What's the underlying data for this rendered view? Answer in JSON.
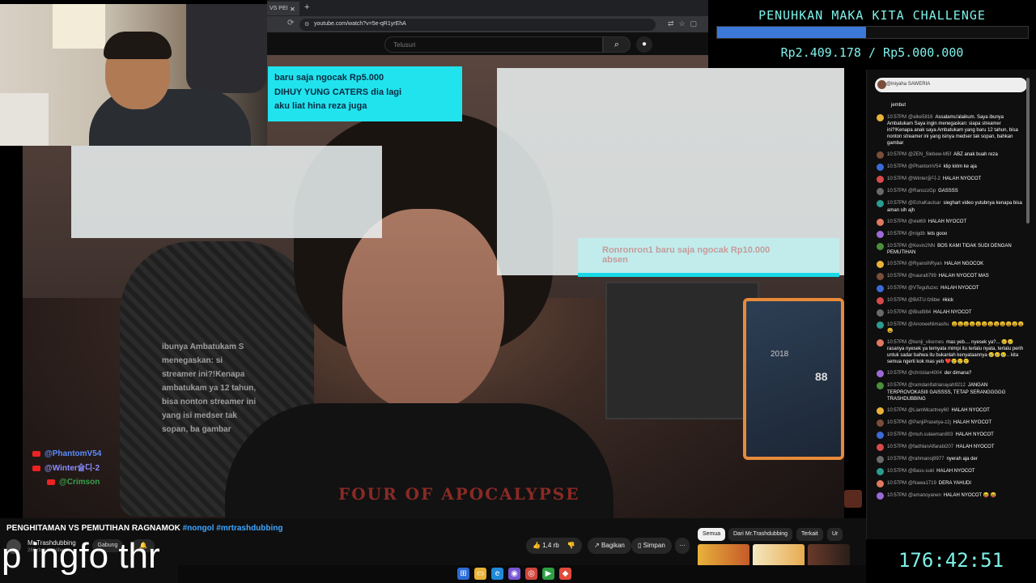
{
  "browser": {
    "tab_label": "VS PEI",
    "new_tab_icon": "+",
    "url": "youtube.com/watch?v=5e-qR1yrEhA",
    "search_placeholder": "Telusuri"
  },
  "challenge": {
    "title": "PENUHKAN MAKA KITA CHALLENGE",
    "amount": "Rp2.409.178 / Rp5.000.000",
    "progress": 0.48
  },
  "overlays": {
    "donation_top": [
      "baru saja ngocak Rp5.000",
      "DIHUY YUNG CATERS dia lagi",
      "aku liat hina reza juga"
    ],
    "donation_right": "Ronronron1 baru saja ngocak Rp10.000",
    "donation_right_sub": "absen",
    "message": "ibunya Ambatukam S menegaskan: si streamer ini?!Kenapa ambatukam ya 12 tahun, bisa nonton streamer ini yang isi medser tak sopan, ba gambar",
    "chat_names": [
      "@PhantomV54",
      "@Winter슬디-2",
      "@Crimson"
    ],
    "shirt_text": "FOUR OF APOCALYPSE"
  },
  "chat": {
    "header": "@iniyaha  SAWERIA  ",
    "messages": [
      {
        "time": "",
        "name": "",
        "text": "jembut"
      },
      {
        "time": "10:57PM",
        "name": "@alke5816",
        "text": "Assalamu'alaikum. Saya ibunya Ambatukam Saya ingin menegaskan: siapa streamer ini?!Kenapa anak saya Ambatukam yang baru 12 tahun, bisa nonton streamer ini yang isinya medser tak sopan, bahkan gambar"
      },
      {
        "time": "10:57PM",
        "name": "@ZEN_Slebew-M5f",
        "text": "ABZ anak buah reza"
      },
      {
        "time": "10:57PM",
        "name": "@PhantomV54",
        "text": "klip kirim ke aja"
      },
      {
        "time": "10:57PM",
        "name": "@Winter슬디-2",
        "text": "HALAH NYOCOT"
      },
      {
        "time": "10:57PM",
        "name": "@RanszzGp",
        "text": "GASSSS"
      },
      {
        "time": "10:57PM",
        "name": "@EchaKautsar",
        "text": "sieghart video yutubnya kenapa bisa aman sih ajh"
      },
      {
        "time": "10:57PM",
        "name": "@xiel69",
        "text": "HALAH NYOCOT"
      },
      {
        "time": "10:57PM",
        "name": "@nigdb",
        "text": "lets gooo"
      },
      {
        "time": "10:57PM",
        "name": "@Kevin2NN",
        "text": "BOS KAMI TIDAK SUDI DENGAN PEMUTIHAN"
      },
      {
        "time": "10:57PM",
        "name": "@RyanslhRyan",
        "text": "HALAH NGOCOK"
      },
      {
        "time": "10:57PM",
        "name": "@naura6799",
        "text": "HALAH NYOCOT MAS"
      },
      {
        "time": "10:57PM",
        "name": "@VTegufuzxc",
        "text": "HALAH NYOCOT"
      },
      {
        "time": "10:57PM",
        "name": "@BATU-fz6bw",
        "text": "#kick"
      },
      {
        "time": "10:57PM",
        "name": "@Blud984",
        "text": "HALAH NYOCOT"
      },
      {
        "time": "10:57PM",
        "name": "@AnoneeNimashu",
        "text": "😩😩😩😩😩😩😩😩😩😩😩😩😩"
      },
      {
        "time": "10:57PM",
        "name": "@kenji_vikernes",
        "text": "mas yeb.... nyesek ya?... 😢😢 rasanya nyesek ya ternyata mimpi itu terlalu nyata, terlalu perih untuk sadar bahwa itu bukanlah kenyataannya 😢😢😢.. kita semua ngerti kok mas yeb ❤️😢😢😢"
      },
      {
        "time": "10:57PM",
        "name": "@christian4004",
        "text": "der dimana?"
      },
      {
        "time": "10:57PM",
        "name": "@ramdanifatrianayah9212",
        "text": "JANGAN TERPROVOKASIII GAISSSS, TETAP SERANGGGGG TRASHDUBBING"
      },
      {
        "time": "10:57PM",
        "name": "@LiamMcartney60",
        "text": "HALAH NYOCOT"
      },
      {
        "time": "10:57PM",
        "name": "@PanjiPrasetya-z2j",
        "text": "HALAH NYOCOT"
      },
      {
        "time": "10:57PM",
        "name": "@muh.sulaeman803",
        "text": "HALAH NYOCOT"
      },
      {
        "time": "10:57PM",
        "name": "@fadhlanAlfarabi207",
        "text": "HALAH NYOCOT"
      },
      {
        "time": "10:57PM",
        "name": "@rahmanoj9977",
        "text": "nyerah aja der"
      },
      {
        "time": "10:57PM",
        "name": "@Bass-sukl",
        "text": "HALAH NYOCOT"
      },
      {
        "time": "10:57PM",
        "name": "@Nawa1719",
        "text": "DERA YAHUDI"
      },
      {
        "time": "10:57PM",
        "name": "@amanoyanen",
        "text": "HALAH NYOCOT 😝 😝"
      }
    ]
  },
  "video": {
    "title_main": "PENGHITAMAN VS PEMUTIHAN RAGNAMOK",
    "title_tags": "#nongol #mrtrashdubbing",
    "channel_name": "Mr.Trashdubbing",
    "channel_subs": "260 rb subscriber",
    "join_label": "Gabung",
    "like_count": "1,4 rb",
    "share_label": "Bagikan",
    "save_label": "Simpan",
    "more_label": "···",
    "filters": [
      "Semua",
      "Dari Mr.Trashdubbing",
      "Terkait",
      "Ur"
    ]
  },
  "caption": "p ingfo thr",
  "timer": "176:42:51",
  "colors": {
    "accent": "#7ef0e8",
    "progress": "#3b78d8",
    "donation": "#20e3ee"
  }
}
